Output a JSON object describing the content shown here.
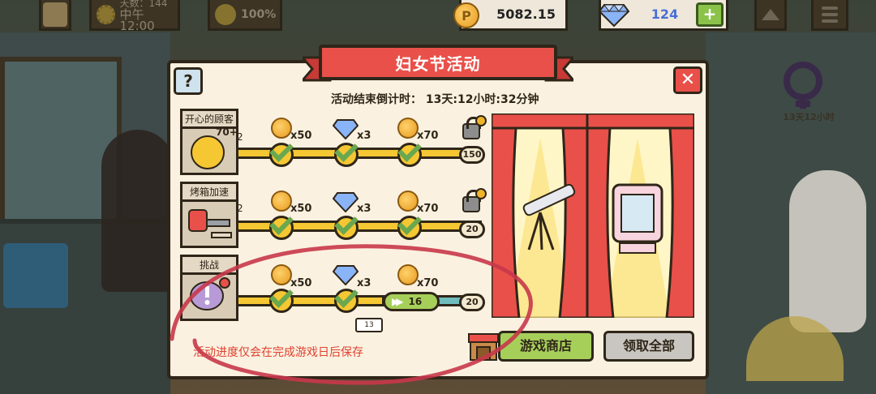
{
  "hud": {
    "days_label": "天数：144",
    "time_label": "中午 12:00",
    "mood_value": "100%",
    "coins": "5082.15",
    "gems": "124",
    "plus_label": "+"
  },
  "event_badge": {
    "timer": "13天12小时"
  },
  "modal": {
    "title": "妇女节活动",
    "help_label": "?",
    "close_label": "✕",
    "countdown": "活动结束倒计时： 13天:12小时:32分钟",
    "note": "活动进度仅会在完成游戏日后保存",
    "shop_button": "游戏商店",
    "claim_button": "领取全部"
  },
  "tracks": [
    {
      "label": "开心的顾客",
      "score": "70+",
      "left_value": "2",
      "rewards": [
        {
          "type": "coin",
          "mult": "x50"
        },
        {
          "type": "gem",
          "mult": "x3"
        },
        {
          "type": "coin",
          "mult": "x70"
        }
      ],
      "milestone": "150"
    },
    {
      "label": "烤箱加速",
      "left_value": "2",
      "rewards": [
        {
          "type": "coin",
          "mult": "x50"
        },
        {
          "type": "gem",
          "mult": "x3"
        },
        {
          "type": "coin",
          "mult": "x70"
        }
      ],
      "milestone": "20"
    },
    {
      "label": "挑战",
      "rewards": [
        {
          "type": "coin",
          "mult": "x50"
        },
        {
          "type": "gem",
          "mult": "x3"
        },
        {
          "type": "coin",
          "mult": "x70"
        }
      ],
      "progress_value": "16",
      "milestone": "20",
      "marker": "13"
    }
  ],
  "colors": {
    "accent_red": "#e9504a",
    "bar_yellow": "#f5c732",
    "button_green": "#a6cf5a",
    "check_green": "#6aa84f",
    "annotation_red": "#c8374a"
  }
}
